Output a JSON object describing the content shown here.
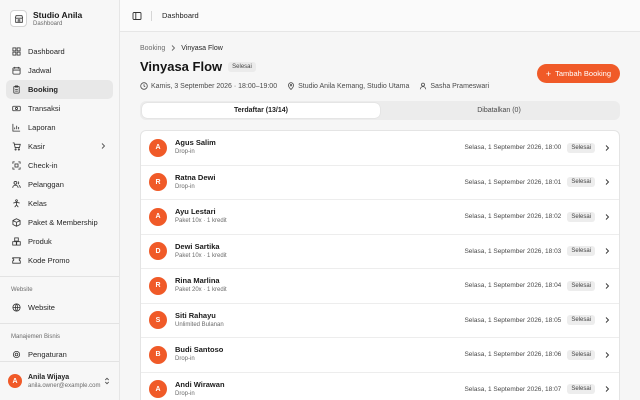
{
  "brand": {
    "name": "Studio Anila",
    "subtitle": "Dashboard"
  },
  "nav": {
    "items": [
      {
        "label": "Dashboard"
      },
      {
        "label": "Jadwal"
      },
      {
        "label": "Booking"
      },
      {
        "label": "Transaksi"
      },
      {
        "label": "Laporan"
      },
      {
        "label": "Kasir"
      },
      {
        "label": "Check-in"
      },
      {
        "label": "Pelanggan"
      },
      {
        "label": "Kelas"
      },
      {
        "label": "Paket & Membership"
      },
      {
        "label": "Produk"
      },
      {
        "label": "Kode Promo"
      }
    ],
    "website_section": "Website",
    "website_item": "Website",
    "business_section": "Manajemen Bisnis",
    "business_item": "Pengaturan"
  },
  "user": {
    "initial": "A",
    "name": "Anila Wijaya",
    "email": "anila.owner@example.com"
  },
  "topbar": {
    "title": "Dashboard"
  },
  "breadcrumb": {
    "parent": "Booking",
    "current": "Vinyasa Flow"
  },
  "page": {
    "title": "Vinyasa Flow",
    "status": "Selesai",
    "datetime": "Kamis, 3 September 2026 · 18:00–19:00",
    "location": "Studio Anila Kemang, Studio Utama",
    "instructor": "Sasha Prameswari",
    "add_button": "Tambah Booking"
  },
  "tabs": {
    "registered": "Terdaftar (13/14)",
    "cancelled": "Dibatalkan (0)"
  },
  "bookings": [
    {
      "initial": "A",
      "name": "Agus Salim",
      "plan": "Drop-in",
      "date": "Selasa, 1 September 2026, 18:00",
      "status": "Selesai"
    },
    {
      "initial": "R",
      "name": "Ratna Dewi",
      "plan": "Drop-in",
      "date": "Selasa, 1 September 2026, 18:01",
      "status": "Selesai"
    },
    {
      "initial": "A",
      "name": "Ayu Lestari",
      "plan": "Paket 10x · 1 kredit",
      "date": "Selasa, 1 September 2026, 18:02",
      "status": "Selesai"
    },
    {
      "initial": "D",
      "name": "Dewi Sartika",
      "plan": "Paket 10x · 1 kredit",
      "date": "Selasa, 1 September 2026, 18:03",
      "status": "Selesai"
    },
    {
      "initial": "R",
      "name": "Rina Marlina",
      "plan": "Paket 20x · 1 kredit",
      "date": "Selasa, 1 September 2026, 18:04",
      "status": "Selesai"
    },
    {
      "initial": "S",
      "name": "Siti Rahayu",
      "plan": "Unlimited Bulanan",
      "date": "Selasa, 1 September 2026, 18:05",
      "status": "Selesai"
    },
    {
      "initial": "B",
      "name": "Budi Santoso",
      "plan": "Drop-in",
      "date": "Selasa, 1 September 2026, 18:06",
      "status": "Selesai"
    },
    {
      "initial": "A",
      "name": "Andi Wirawan",
      "plan": "Drop-in",
      "date": "Selasa, 1 September 2026, 18:07",
      "status": "Selesai"
    }
  ],
  "colors": {
    "accent": "#f05a28",
    "sidebar_bg": "#f7f7f7",
    "main_bg": "#f6f6f6"
  }
}
